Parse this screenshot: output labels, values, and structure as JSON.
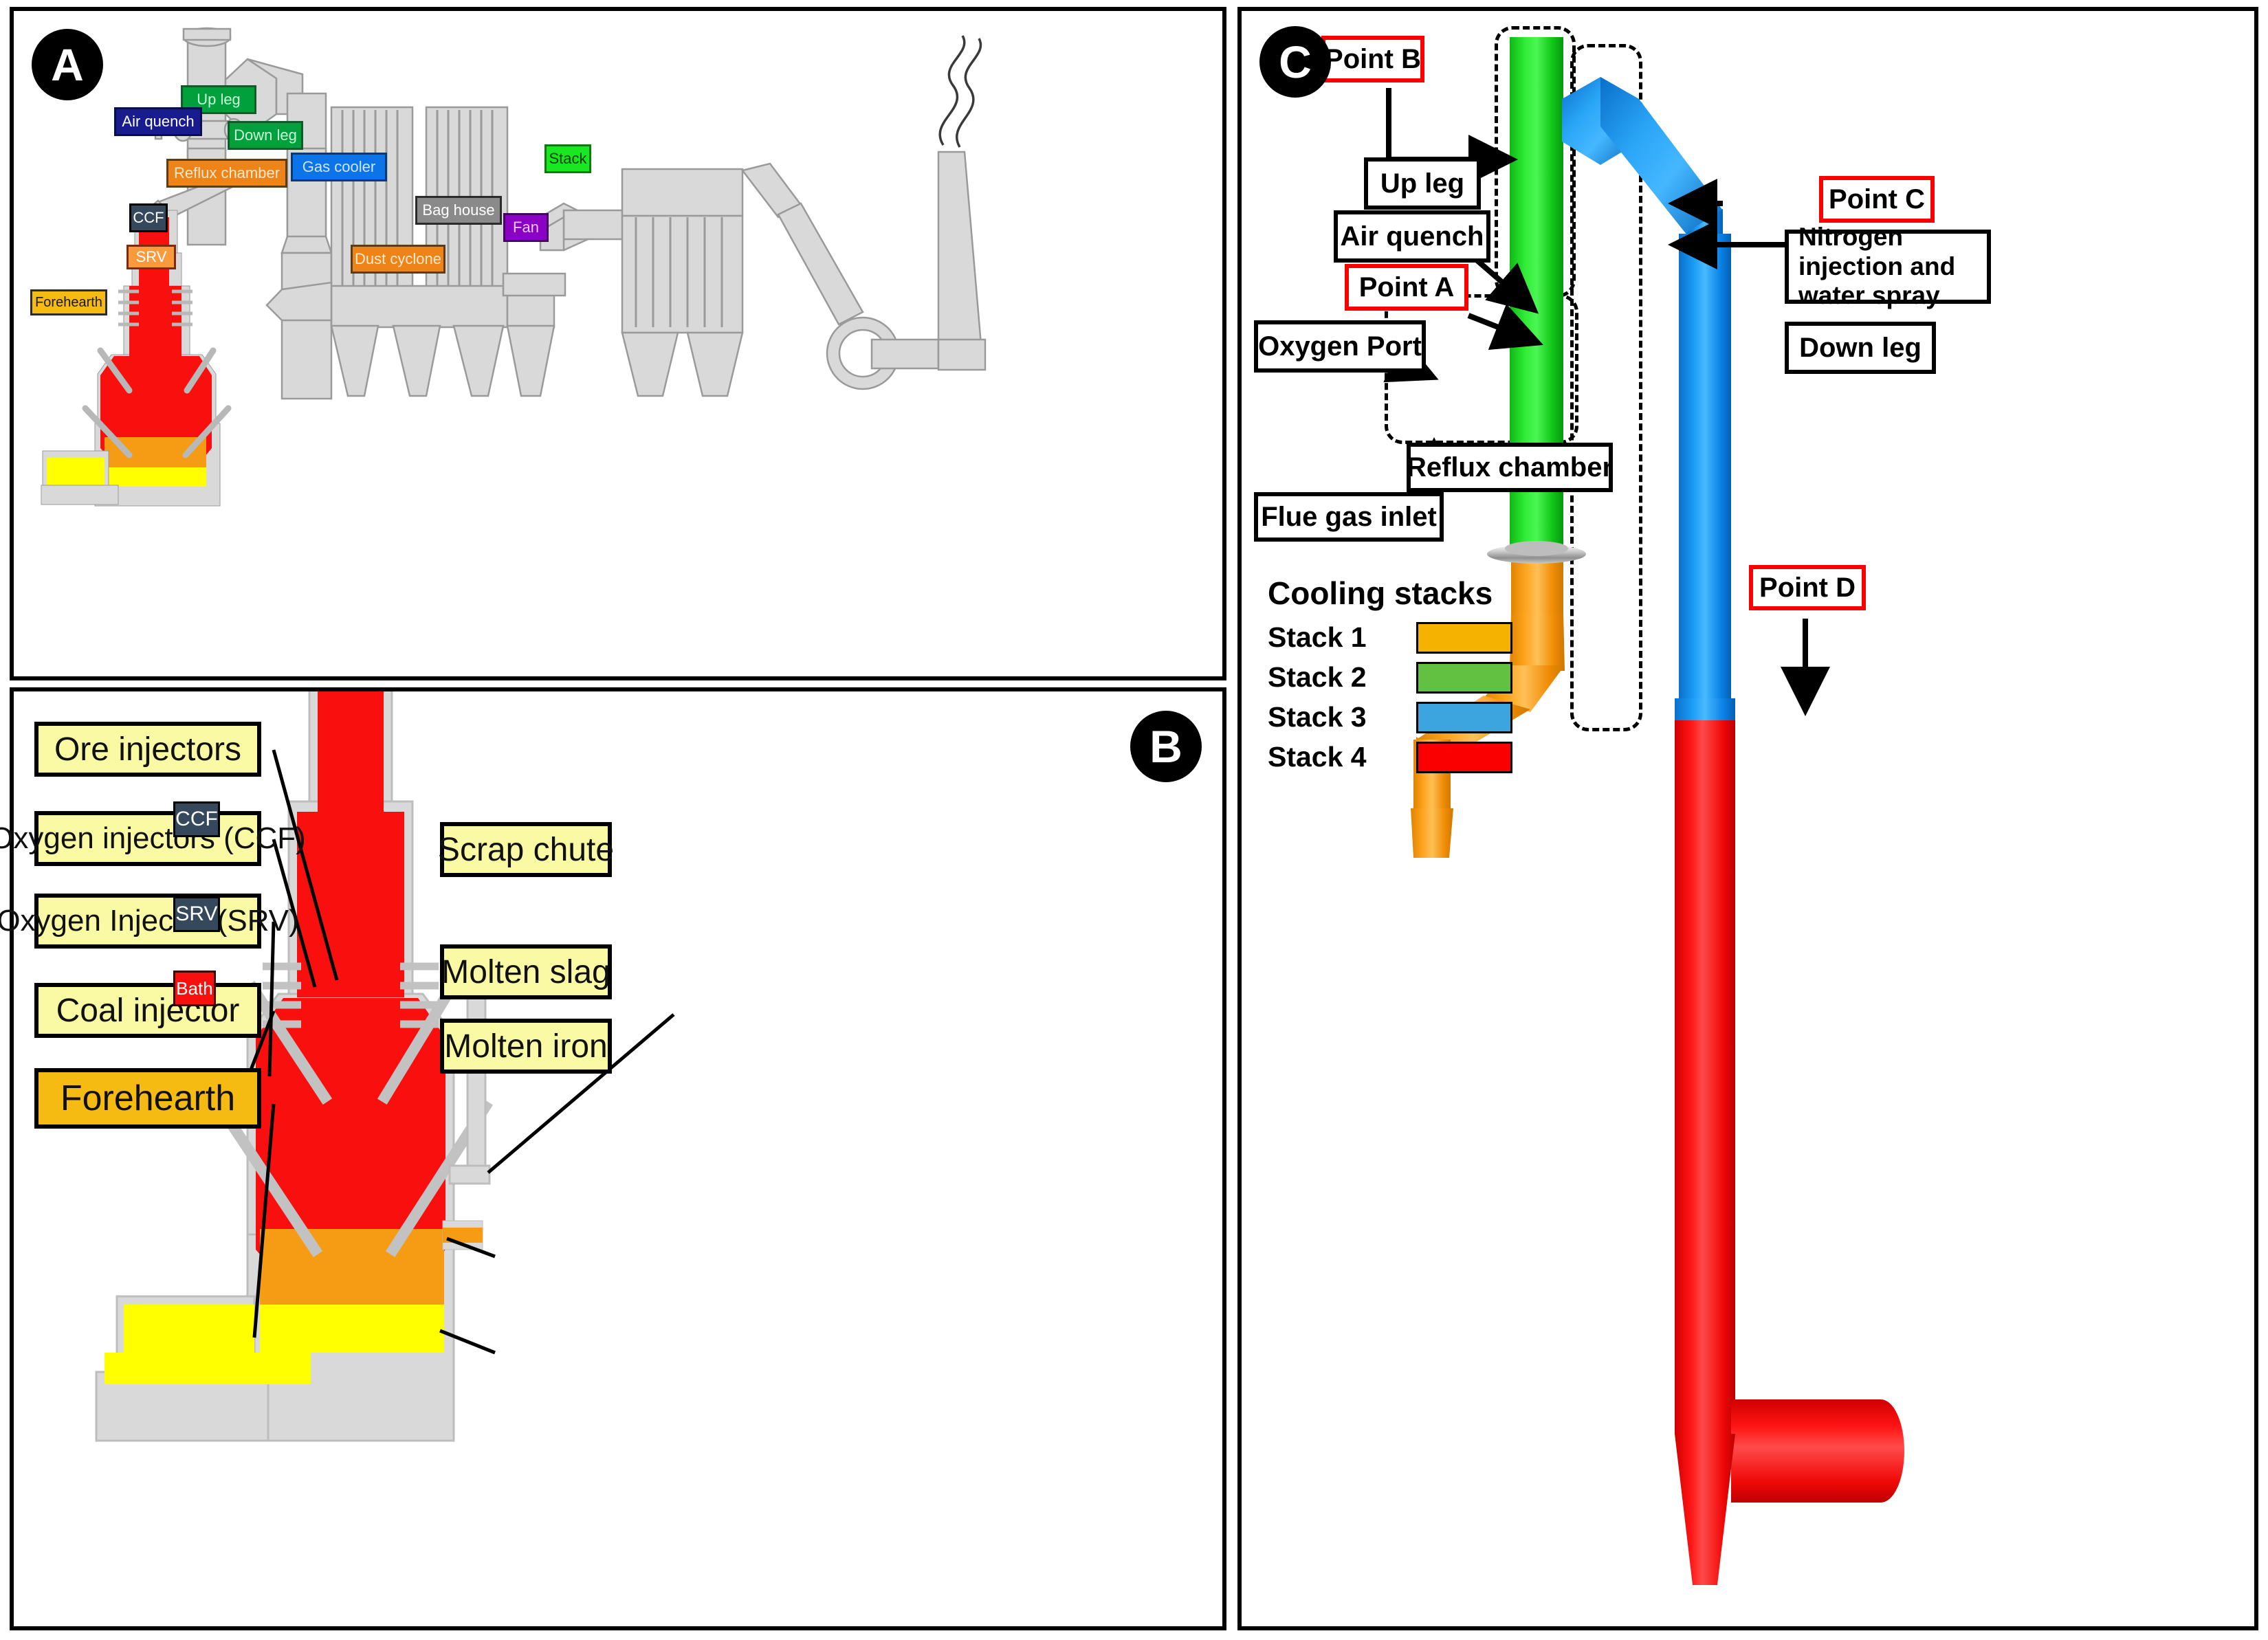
{
  "panels": {
    "a": {
      "badge": "A"
    },
    "b": {
      "badge": "B"
    },
    "c": {
      "badge": "C"
    }
  },
  "panel_a": {
    "tags": [
      {
        "id": "up-leg",
        "label": "Up leg",
        "color": "green"
      },
      {
        "id": "air-quench",
        "label": "Air quench",
        "color": "navy"
      },
      {
        "id": "down-leg",
        "label": "Down leg",
        "color": "green"
      },
      {
        "id": "reflux-chamber",
        "label": "Reflux chamber",
        "color": "orange"
      },
      {
        "id": "gas-cooler",
        "label": "Gas cooler",
        "color": "blue"
      },
      {
        "id": "bag-house",
        "label": "Bag house",
        "color": "grey"
      },
      {
        "id": "dust-cyclone",
        "label": "Dust cyclone",
        "color": "orange"
      },
      {
        "id": "fan",
        "label": "Fan",
        "color": "purple"
      },
      {
        "id": "stack",
        "label": "Stack",
        "color": "lime"
      },
      {
        "id": "ccf",
        "label": "CCF",
        "color": "dark"
      },
      {
        "id": "srv",
        "label": "SRV",
        "color": "srv"
      },
      {
        "id": "forehearth",
        "label": "Forehearth",
        "color": "amber"
      }
    ]
  },
  "panel_b": {
    "left_labels": [
      {
        "id": "ore-injectors",
        "label": "Ore injectors"
      },
      {
        "id": "oxygen-injectors-ccf",
        "label": "Oxygen injectors (CCF)"
      },
      {
        "id": "oxygen-injector-srv",
        "label": "Oxygen Injector (SRV)"
      },
      {
        "id": "coal-injector",
        "label": "Coal injector"
      },
      {
        "id": "forehearth",
        "label": "Forehearth"
      }
    ],
    "right_labels": [
      {
        "id": "scrap-chute",
        "label": "Scrap chute"
      },
      {
        "id": "molten-slag",
        "label": "Molten slag"
      },
      {
        "id": "molten-iron",
        "label": "Molten iron"
      }
    ],
    "vessel_tags": [
      {
        "id": "ccf",
        "label": "CCF"
      },
      {
        "id": "srv",
        "label": "SRV"
      },
      {
        "id": "bath",
        "label": "Bath"
      }
    ]
  },
  "panel_c": {
    "labels": [
      {
        "id": "point-b",
        "label": "Point B",
        "style": "red"
      },
      {
        "id": "up-leg",
        "label": "Up leg",
        "style": "black"
      },
      {
        "id": "air-quench",
        "label": "Air quench",
        "style": "black"
      },
      {
        "id": "point-a",
        "label": "Point A",
        "style": "red"
      },
      {
        "id": "oxygen-port",
        "label": "Oxygen Port",
        "style": "black"
      },
      {
        "id": "reflux-chamber",
        "label": "Reflux chamber",
        "style": "black"
      },
      {
        "id": "flue-gas-inlet",
        "label": "Flue gas inlet",
        "style": "black"
      },
      {
        "id": "point-c",
        "label": "Point C",
        "style": "red"
      },
      {
        "id": "nitrogen",
        "label": "Nitrogen injection and water spray",
        "style": "black"
      },
      {
        "id": "down-leg",
        "label": "Down leg",
        "style": "black"
      },
      {
        "id": "point-d",
        "label": "Point D",
        "style": "red"
      }
    ],
    "legend": {
      "title": "Cooling stacks",
      "items": [
        {
          "label": "Stack 1",
          "color": "#f5b300"
        },
        {
          "label": "Stack 2",
          "color": "#62c141"
        },
        {
          "label": "Stack 3",
          "color": "#3ca5e0"
        },
        {
          "label": "Stack 4",
          "color": "#fa0000"
        }
      ]
    }
  },
  "colors": {
    "stack1": "#f5b300",
    "stack2": "#62c141",
    "stack3": "#3ca5e0",
    "stack4": "#fa0000",
    "duct_grey": "#d9d9d9",
    "hot_red": "#fa0f0f",
    "slag_orange": "#f59b14",
    "iron_yellow": "#ffff00",
    "point_red": "#fa0000"
  }
}
